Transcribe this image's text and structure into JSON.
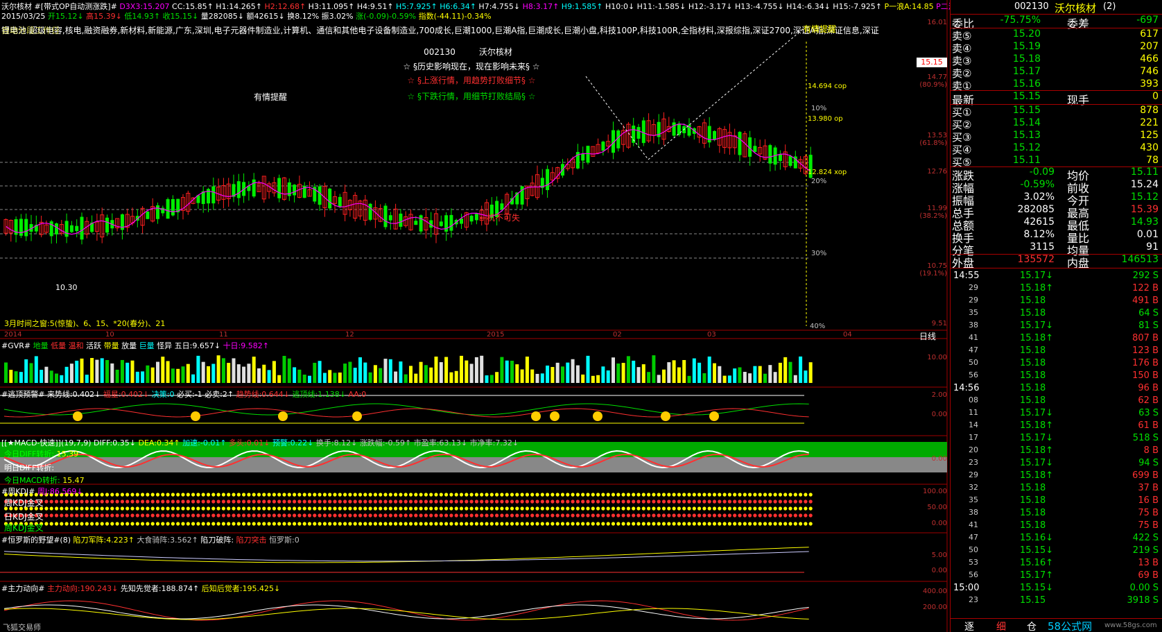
{
  "colors": {
    "red": "#ff3030",
    "green": "#00e000",
    "cyan": "#00ffff",
    "yellow": "#ffff00",
    "white": "#ffffff",
    "magenta": "#ff00ff",
    "gray": "#c0c0c0",
    "panel_border": "#a00000",
    "bar_green": "#00ee00",
    "bar_red": "#ff2020"
  },
  "header": {
    "title": "沃尔核材",
    "formula": "#[带式OP自动测涨跌]#",
    "row1": [
      {
        "t": "D3X3:15.207",
        "c": "magenta"
      },
      {
        "t": "CC:15.85↑",
        "c": "white"
      },
      {
        "t": "H1:14.265↑",
        "c": "white"
      },
      {
        "t": "H2:12.68↑",
        "c": "red"
      },
      {
        "t": "H3:11.095↑",
        "c": "white"
      },
      {
        "t": "H4:9.51↑",
        "c": "white"
      },
      {
        "t": "H5:7.925↑",
        "c": "cyan"
      },
      {
        "t": "H6:6.34↑",
        "c": "cyan"
      },
      {
        "t": "H7:4.755↓",
        "c": "white"
      },
      {
        "t": "H8:3.17↑",
        "c": "magenta"
      },
      {
        "t": "H9:1.585↑",
        "c": "cyan"
      },
      {
        "t": "H10:0↓",
        "c": "white"
      },
      {
        "t": "H11:-1.585↓",
        "c": "white"
      },
      {
        "t": "H12:-3.17↓",
        "c": "white"
      },
      {
        "t": "H13:-4.755↓",
        "c": "white"
      },
      {
        "t": "H14:-6.34↓",
        "c": "white"
      },
      {
        "t": "H15:-7.925↑",
        "c": "white"
      },
      {
        "t": "P一浪A:14.85",
        "c": "yellow"
      },
      {
        "t": "P二浪B",
        "c": "magenta"
      }
    ],
    "date": "2015/03/25",
    "row2": [
      {
        "t": "开15.12↓",
        "c": "green"
      },
      {
        "t": "高15.39↓",
        "c": "red"
      },
      {
        "t": "低14.93↑",
        "c": "green"
      },
      {
        "t": "收15.15↓",
        "c": "green"
      },
      {
        "t": "量282085↓",
        "c": "white"
      },
      {
        "t": "额42615↓",
        "c": "white"
      },
      {
        "t": "换8.12%",
        "c": "white"
      },
      {
        "t": "振3.02%",
        "c": "white"
      },
      {
        "t": "涨(-0.09)-0.59%",
        "c": "green"
      },
      {
        "t": "指数(-44.11)-0.34%",
        "c": "yellow"
      }
    ],
    "concepts": "锂电池 超级电容,核电,融资融券,新材料,新能源,广东,深圳,电子元器件制造业,计算机、通信和其他电子设备制造业,700成长,巨潮1000,巨潮A指,巨潮成长,巨潮小盘,科技100P,科技100R,全指材料,深报综指,深证2700,深证A指,深证信息,深证",
    "overlay_text_top": "自动分段工作日",
    "remind": "有情提醒"
  },
  "center_box": {
    "code": "002130",
    "name": "沃尔核材",
    "line1": "☆ §历史影响现在，现在影响未来§ ☆",
    "line2": "☆ §上涨行情，用趋势打败细节§ ☆",
    "line3": "☆ §下跌行情，用细节打败结局§ ☆"
  },
  "annotations": {
    "low_price": "10.30",
    "not_buy": "←机不可失",
    "time_window": "3月时间之窗:5(惊蛰)、6、15、*20(春分)、21",
    "remind_right": "有情提醒",
    "cop": "14.694 cop",
    "op": "13.980 op",
    "xop": "12.824 xop",
    "pct10": "10%",
    "pct20": "20%",
    "pct30": "30%",
    "pct40": "40%",
    "cur_price_tag": "15.15"
  },
  "price_axis": [
    {
      "v": "16.01",
      "p": ""
    },
    {
      "v": "14.77",
      "p": "(80.9%)"
    },
    {
      "v": "13.53",
      "p": "(61.8%)"
    },
    {
      "v": "12.76",
      "p": ""
    },
    {
      "v": "11.99",
      "p": "(38.2%)"
    },
    {
      "v": "10.75",
      "p": "(19.1%)"
    },
    {
      "v": "9.51",
      "p": ""
    }
  ],
  "date_axis": [
    "2014",
    "10",
    "11",
    "12",
    "2015",
    "02",
    "03",
    "04"
  ],
  "period": "日线",
  "panels": {
    "gvr": {
      "title": "#GVR#",
      "items": [
        {
          "t": "地量",
          "c": "green"
        },
        {
          "t": "低量",
          "c": "red"
        },
        {
          "t": "温和",
          "c": "red"
        },
        {
          "t": "活跃",
          "c": "white"
        },
        {
          "t": "带量",
          "c": "yellow"
        },
        {
          "t": "放量",
          "c": "white"
        },
        {
          "t": "巨量",
          "c": "cyan"
        },
        {
          "t": "怪异",
          "c": "white"
        },
        {
          "t": "五日:9.657↓",
          "c": "white"
        },
        {
          "t": "十日:9.582↑",
          "c": "magenta"
        }
      ],
      "axis": [
        "10.00"
      ]
    },
    "escape": {
      "title": "#逃顶预警#",
      "items": [
        {
          "t": "来势线:0.402↓",
          "c": "white"
        },
        {
          "t": "福星:0.402↓",
          "c": "red"
        },
        {
          "t": "决策:0",
          "c": "cyan"
        },
        {
          "t": "必买:-1",
          "c": "white"
        },
        {
          "t": "必卖:2↑",
          "c": "white"
        },
        {
          "t": "趋势线:0.644↓",
          "c": "red"
        },
        {
          "t": "逃顶线:1.138↓",
          "c": "green"
        },
        {
          "t": "AA:0",
          "c": "red"
        }
      ],
      "axis": [
        "2.00",
        "0.00"
      ]
    },
    "macd": {
      "title": "[[★MACD-快速]](19,7,9)",
      "items": [
        {
          "t": "DIFF:0.35↓",
          "c": "white"
        },
        {
          "t": "DEA:0.34↑",
          "c": "yellow"
        },
        {
          "t": "加速:-0.01↑",
          "c": "cyan"
        },
        {
          "t": "多头:0.01↓",
          "c": "red"
        },
        {
          "t": "预警:0.22↓",
          "c": "cyan"
        },
        {
          "t": "换手:8.12↓",
          "c": "gray"
        },
        {
          "t": "涨跌幅:-0.59↑",
          "c": "gray"
        },
        {
          "t": "市盈率:63.13↓",
          "c": "gray"
        },
        {
          "t": "市净率:7.32↓",
          "c": "gray"
        }
      ],
      "left1": "今日DIFF转折:",
      "left1v": "15.39",
      "left2": "明日DIFF转折:",
      "left3": "今日MACD转折:",
      "left3v": "15.47",
      "axis": [
        "0.00"
      ]
    },
    "kdj": {
      "title": "#周KDJ#",
      "items": [
        {
          "t": "周J:86.569↓",
          "c": "magenta"
        }
      ],
      "left1": "周KDJ金叉",
      "left2": "日KDJ金叉",
      "left3": "周KDJ金叉",
      "axis": [
        "100.00",
        "50.00",
        "0.00"
      ]
    },
    "heng": {
      "title": "#恒罗斯的野望#(8)",
      "items": [
        {
          "t": "陷刀军阵:4.223↑",
          "c": "yellow"
        },
        {
          "t": "大食骑阵:3.562↑",
          "c": "gray"
        },
        {
          "t": "陷刀破阵:",
          "c": "white"
        },
        {
          "t": "陷刀突击",
          "c": "red"
        },
        {
          "t": "恒罗斯:0",
          "c": "gray"
        }
      ],
      "axis": [
        "5.00",
        "0.00"
      ]
    },
    "main": {
      "title": "#主力动向#",
      "items": [
        {
          "t": "主力动向:190.243↓",
          "c": "red"
        },
        {
          "t": "先知先觉者:188.874↑",
          "c": "white"
        },
        {
          "t": "后知后觉者:195.425↓",
          "c": "yellow"
        }
      ],
      "axis": [
        "400.00",
        "200.00"
      ],
      "bottom": "飞狐交易师"
    }
  },
  "side": {
    "code": "002130",
    "name": "沃尔核材",
    "badge": "(2)",
    "wb_label": "委比",
    "wb_pct": "-75.75%",
    "wc_label": "委差",
    "wc_val": "-697",
    "sells": [
      {
        "l": "卖⑤",
        "p": "15.20",
        "v": "617"
      },
      {
        "l": "卖④",
        "p": "15.19",
        "v": "207"
      },
      {
        "l": "卖③",
        "p": "15.18",
        "v": "466"
      },
      {
        "l": "卖②",
        "p": "15.17",
        "v": "746"
      },
      {
        "l": "卖①",
        "p": "15.16",
        "v": "393"
      }
    ],
    "latest_label": "最新",
    "latest": "15.15",
    "now_label": "现手",
    "now": "0",
    "buys": [
      {
        "l": "买①",
        "p": "15.15",
        "v": "878"
      },
      {
        "l": "买②",
        "p": "15.14",
        "v": "221"
      },
      {
        "l": "买③",
        "p": "15.13",
        "v": "125"
      },
      {
        "l": "买④",
        "p": "15.12",
        "v": "430"
      },
      {
        "l": "买⑤",
        "p": "15.11",
        "v": "78"
      }
    ],
    "stats": [
      {
        "a": "涨跌",
        "av": "-0.09",
        "ac": "green",
        "b": "均价",
        "bv": "15.11",
        "bc": "green"
      },
      {
        "a": "涨幅",
        "av": "-0.59%",
        "ac": "green",
        "b": "前收",
        "bv": "15.24",
        "bc": "white"
      },
      {
        "a": "振幅",
        "av": "3.02%",
        "ac": "white",
        "b": "今开",
        "bv": "15.12",
        "bc": "green"
      },
      {
        "a": "总手",
        "av": "282085",
        "ac": "white",
        "b": "最高",
        "bv": "15.39",
        "bc": "red"
      },
      {
        "a": "总额",
        "av": "42615",
        "ac": "white",
        "b": "最低",
        "bv": "14.93",
        "bc": "green"
      },
      {
        "a": "换手",
        "av": "8.12%",
        "ac": "white",
        "b": "量比",
        "bv": "0.01",
        "bc": "white"
      },
      {
        "a": "分笔",
        "av": "3115",
        "ac": "white",
        "b": "均量",
        "bv": "91",
        "bc": "white"
      }
    ],
    "wp_label": "外盘",
    "wp": "135572",
    "np_label": "内盘",
    "np": "146513",
    "ticks": [
      {
        "t": "14:55",
        "p": "15.17↓",
        "v": "292 S"
      },
      {
        "t": "29",
        "p": "15.18↑",
        "v": "122 B"
      },
      {
        "t": "29",
        "p": "15.18",
        "v": "491 B"
      },
      {
        "t": "35",
        "p": "15.18",
        "v": "64 S"
      },
      {
        "t": "38",
        "p": "15.17↓",
        "v": "81 S"
      },
      {
        "t": "41",
        "p": "15.18↑",
        "v": "807 B"
      },
      {
        "t": "47",
        "p": "15.18",
        "v": "123 B"
      },
      {
        "t": "50",
        "p": "15.18",
        "v": "176 B"
      },
      {
        "t": "56",
        "p": "15.18",
        "v": "150 B"
      },
      {
        "t": "14:56",
        "p": "15.18",
        "v": "96 B"
      },
      {
        "t": "08",
        "p": "15.18",
        "v": "62 B"
      },
      {
        "t": "11",
        "p": "15.17↓",
        "v": "63 S"
      },
      {
        "t": "14",
        "p": "15.18↑",
        "v": "61 B"
      },
      {
        "t": "17",
        "p": "15.17↓",
        "v": "518 S"
      },
      {
        "t": "20",
        "p": "15.18↑",
        "v": "8 B"
      },
      {
        "t": "23",
        "p": "15.17↓",
        "v": "94 S"
      },
      {
        "t": "29",
        "p": "15.18↑",
        "v": "699 B"
      },
      {
        "t": "32",
        "p": "15.18",
        "v": "37 B"
      },
      {
        "t": "35",
        "p": "15.18",
        "v": "16 B"
      },
      {
        "t": "38",
        "p": "15.18",
        "v": "75 B"
      },
      {
        "t": "41",
        "p": "15.18",
        "v": "75 B"
      },
      {
        "t": "47",
        "p": "15.16↓",
        "v": "422 S"
      },
      {
        "t": "50",
        "p": "15.15↓",
        "v": "219 S"
      },
      {
        "t": "53",
        "p": "15.16↑",
        "v": "13 B"
      },
      {
        "t": "56",
        "p": "15.17↑",
        "v": "69 B"
      },
      {
        "t": "15:00",
        "p": "15.15↓",
        "v": "0.00 S"
      },
      {
        "t": "23",
        "p": "15.15",
        "v": "3918 S"
      }
    ],
    "tabs": [
      "逐",
      "细",
      "仓"
    ],
    "watermark": "58公式网",
    "watermark_url": "www.58gs.com"
  }
}
